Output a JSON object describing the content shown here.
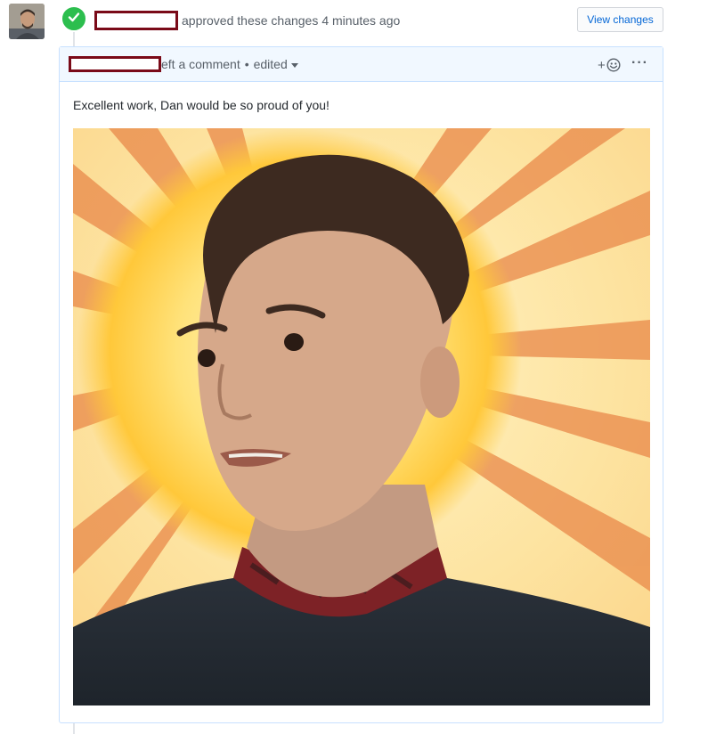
{
  "review": {
    "action_text": "approved these changes",
    "time_text": "4 minutes ago",
    "view_changes_label": "View changes"
  },
  "comment": {
    "action_text": "eft a comment",
    "separator": "•",
    "edited_label": "edited",
    "reaction_plus": "+",
    "more_label": "···",
    "body_text": "Excellent work, Dan would be so proud of you!"
  },
  "icons": {
    "status": "check-icon",
    "reaction": "smiley-icon",
    "more": "kebab-horizontal-icon"
  },
  "colors": {
    "approved_green": "#2cbe4e",
    "link_blue": "#0366d6",
    "header_bg": "#f1f8ff",
    "border_blue": "#c8e1ff",
    "redaction": "#7a0a18"
  }
}
